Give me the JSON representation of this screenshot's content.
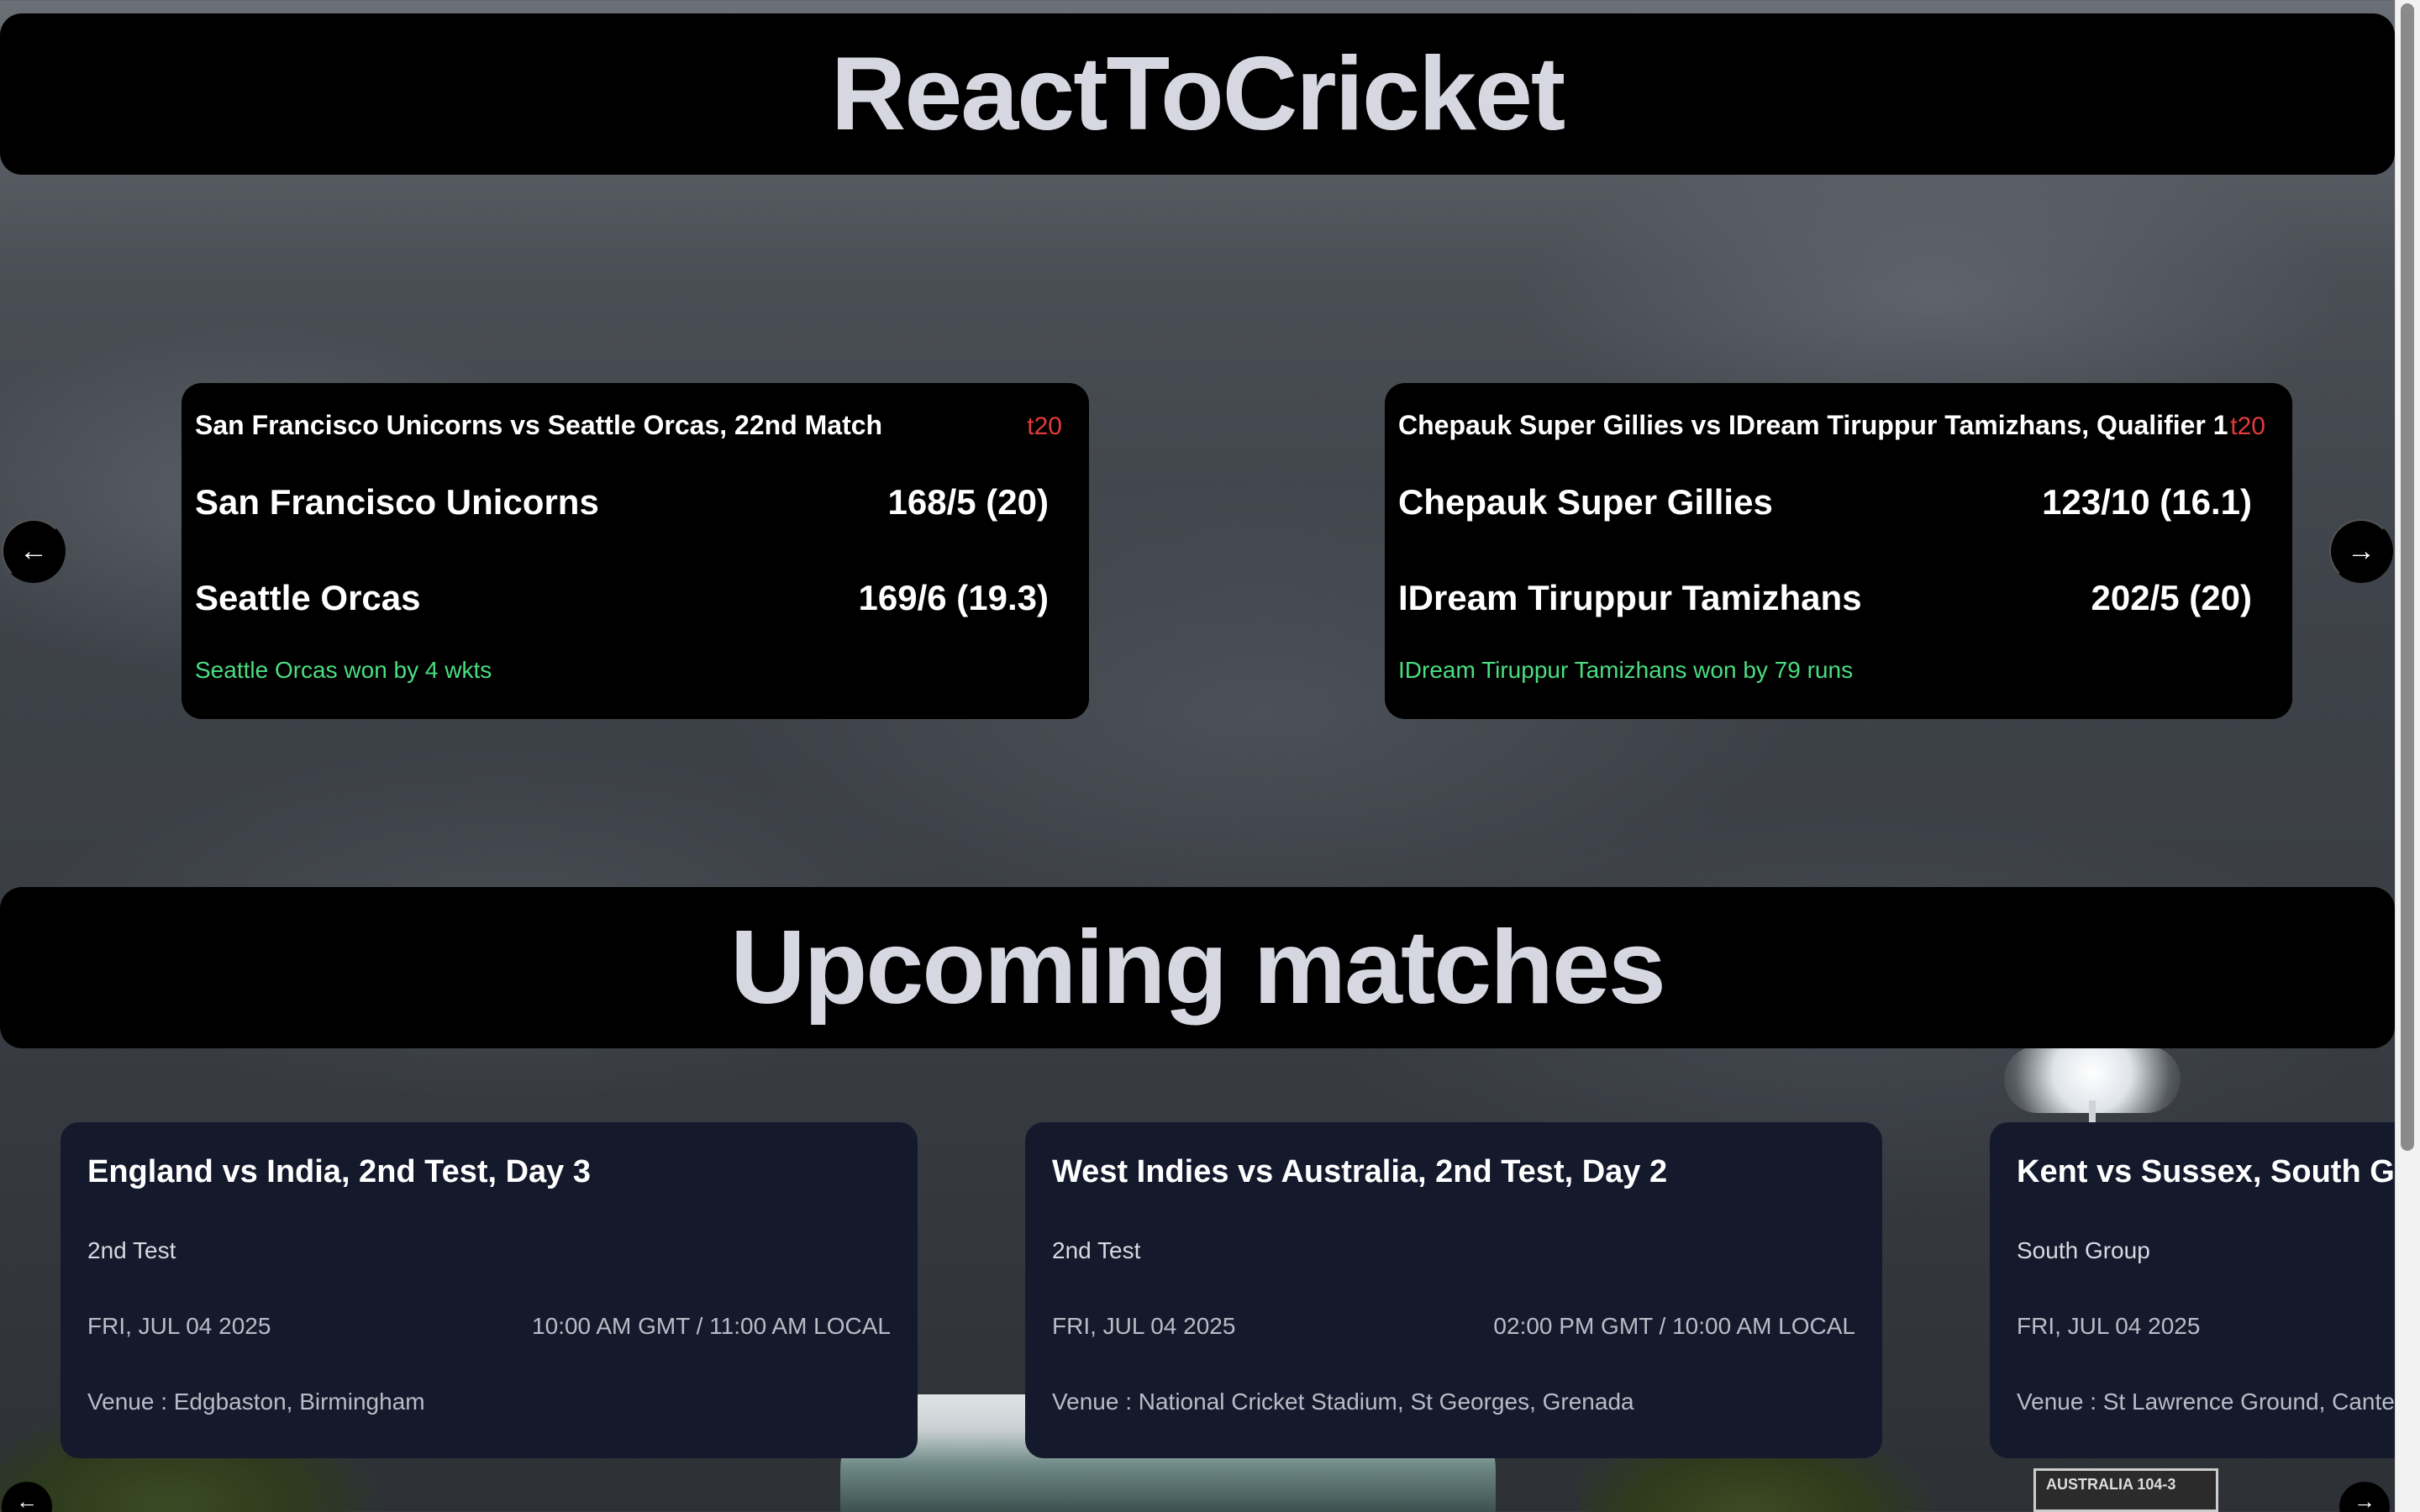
{
  "app": {
    "title": "ReactToCricket"
  },
  "live": {
    "cards": [
      {
        "title": "San Francisco Unicorns vs Seattle Orcas, 22nd Match",
        "format": "t20",
        "team1": {
          "name": "San Francisco Unicorns",
          "score": "168/5 (20)"
        },
        "team2": {
          "name": "Seattle Orcas",
          "score": "169/6 (19.3)"
        },
        "result": "Seattle Orcas won by 4 wkts"
      },
      {
        "title": "Chepauk Super Gillies vs IDream Tiruppur Tamizhans, Qualifier 1",
        "format": "t20",
        "team1": {
          "name": "Chepauk Super Gillies",
          "score": "123/10 (16.1)"
        },
        "team2": {
          "name": "IDream Tiruppur Tamizhans",
          "score": "202/5 (20)"
        },
        "result": "IDream Tiruppur Tamizhans won by 79 runs"
      }
    ],
    "prev_icon": "arrow-left-icon",
    "next_icon": "arrow-right-icon"
  },
  "upcoming": {
    "heading": "Upcoming matches",
    "matches": [
      {
        "title": "England vs India, 2nd Test, Day 3",
        "desc": "2nd Test",
        "date": "FRI, JUL 04 2025",
        "time": "10:00 AM GMT / 11:00 AM LOCAL",
        "venue": "Venue : Edgbaston, Birmingham"
      },
      {
        "title": "West Indies vs Australia, 2nd Test, Day 2",
        "desc": "2nd Test",
        "date": "FRI, JUL 04 2025",
        "time": "02:00 PM GMT / 10:00 AM LOCAL",
        "venue": "Venue : National Cricket Stadium, St Georges, Grenada"
      },
      {
        "title": "Kent vs Sussex, South Gro",
        "desc": "South Group",
        "date": "FRI, JUL 04 2025",
        "time": "",
        "venue": "Venue : St Lawrence Ground, Cante"
      }
    ]
  },
  "background": {
    "scoreboard_text": "AUSTRALIA 104-3"
  },
  "colors": {
    "format_tag": "#e43a3a",
    "result_text": "#4ade80",
    "header_text": "#d6d7e0",
    "card_live_bg": "#000000",
    "card_upcoming_bg": "#141a2c"
  }
}
